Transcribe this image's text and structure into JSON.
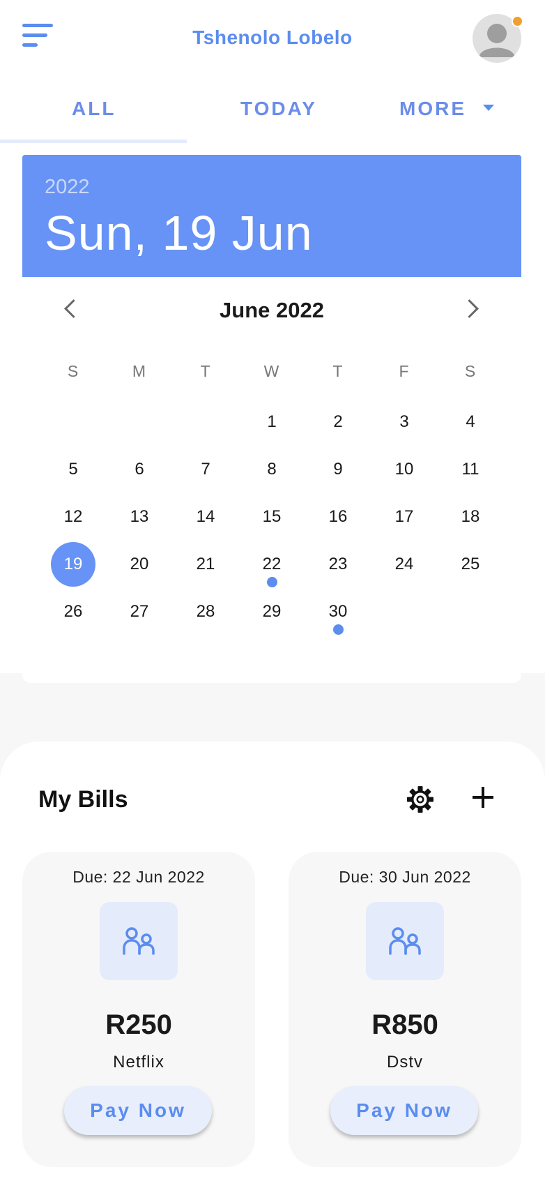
{
  "header": {
    "user_name": "Tshenolo Lobelo",
    "menu_icon": "menu-icon",
    "avatar_icon": "avatar-icon",
    "notification_color": "#f0a030"
  },
  "tabs": [
    {
      "label": "ALL",
      "active": true
    },
    {
      "label": "TODAY",
      "active": false
    },
    {
      "label": "MORE",
      "active": false,
      "has_dropdown": true
    }
  ],
  "date_header": {
    "year": "2022",
    "full_date": "Sun, 19 Jun"
  },
  "calendar": {
    "month_label": "June 2022",
    "weekdays": [
      "S",
      "M",
      "T",
      "W",
      "T",
      "F",
      "S"
    ],
    "first_weekday_index": 3,
    "days_in_month": 30,
    "day_labels": [
      "1",
      "2",
      "3",
      "4",
      "5",
      "6",
      "7",
      "8",
      "9",
      "10",
      "11",
      "12",
      "13",
      "14",
      "15",
      "16",
      "17",
      "18",
      "19",
      "20",
      "21",
      "22",
      "23",
      "24",
      "25",
      "26",
      "27",
      "28",
      "29",
      "30"
    ],
    "selected_day": 19,
    "event_days": [
      22,
      30
    ],
    "prev_icon": "chevron-left-icon",
    "next_icon": "chevron-right-icon"
  },
  "bills": {
    "title": "My Bills",
    "settings_icon": "gear-icon",
    "add_icon": "plus-icon",
    "items": [
      {
        "due": "Due: 22 Jun 2022",
        "amount": "R250",
        "name": "Netflix",
        "button": "Pay Now",
        "icon": "people-icon"
      },
      {
        "due": "Due: 30 Jun 2022",
        "amount": "R850",
        "name": "Dstv",
        "button": "Pay Now",
        "icon": "people-icon"
      }
    ]
  },
  "colors": {
    "accent": "#5b8def",
    "header_blue": "#6693f5",
    "tab_indicator": "#e4ebfb"
  }
}
